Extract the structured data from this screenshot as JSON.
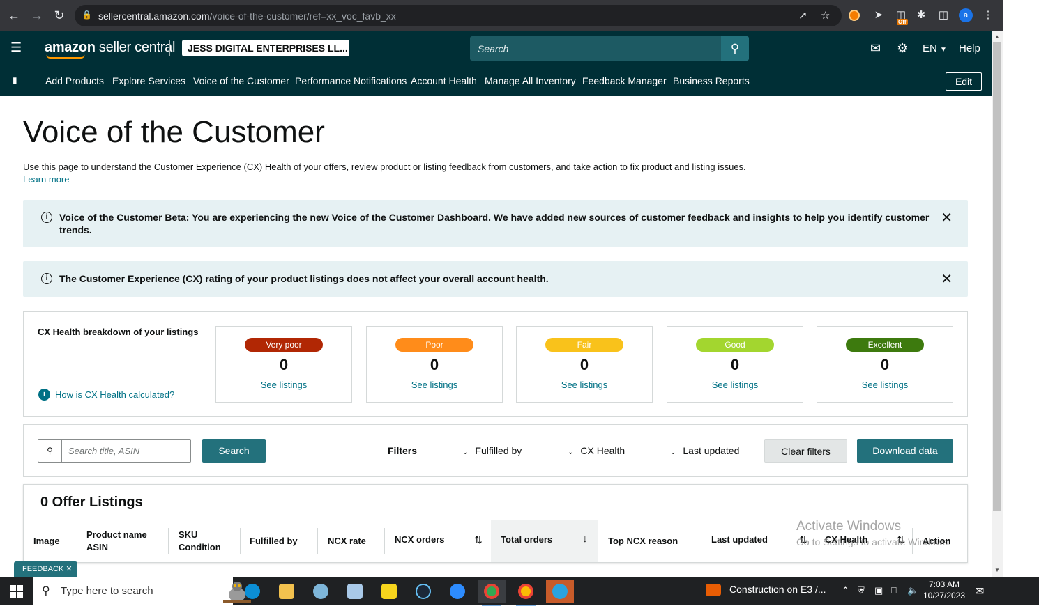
{
  "browser": {
    "url_host": "sellercentral.amazon.com",
    "url_path": "/voice-of-the-customer/ref=xx_voc_favb_xx",
    "profile_initial": "a",
    "ext_badge": "Off"
  },
  "header": {
    "logo_amazon": "amazon",
    "logo_rest": " seller central",
    "account": "JESS DIGITAL ENTERPRISES LL...",
    "search_placeholder": "Search",
    "language": "EN",
    "help": "Help"
  },
  "nav": {
    "links": [
      "Add Products",
      "Explore Services",
      "Voice of the Customer",
      "Performance Notifications",
      "Account Health",
      "Manage All Inventory",
      "Feedback Manager",
      "Business Reports"
    ],
    "edit": "Edit"
  },
  "page": {
    "title": "Voice of the Customer",
    "description": "Use this page to understand the Customer Experience (CX) Health of your offers, review product or listing feedback from customers, and take action to fix product and listing issues.",
    "learn_more": "Learn more"
  },
  "alerts": {
    "beta_line1": "Voice of the Customer Beta: You are experiencing the new Voice of the Customer Dashboard. We have added new sources of customer feedback and insights to help you identify customer",
    "beta_line2": "trends.",
    "cx_rating": "The Customer Experience (CX) rating of your product listings does not affect your overall account health."
  },
  "cx_health": {
    "title": "CX Health breakdown of your listings",
    "help_link": "How is CX Health calculated?",
    "see_listings": "See listings",
    "tiles": [
      {
        "label": "Very poor",
        "count": "0",
        "color": "#b12704"
      },
      {
        "label": "Poor",
        "count": "0",
        "color": "#ff8c1a"
      },
      {
        "label": "Fair",
        "count": "0",
        "color": "#f9c21b"
      },
      {
        "label": "Good",
        "count": "0",
        "color": "#a3d62f"
      },
      {
        "label": "Excellent",
        "count": "0",
        "color": "#3d7a0e"
      }
    ]
  },
  "filters": {
    "search_placeholder": "Search title, ASIN",
    "search_button": "Search",
    "filters_label": "Filters",
    "fulfilled_by": "Fulfilled by",
    "cx_health": "CX Health",
    "last_updated": "Last updated",
    "clear": "Clear filters",
    "download": "Download data"
  },
  "listings": {
    "title": "0 Offer Listings",
    "columns": {
      "image": "Image",
      "product_name": "Product name",
      "asin": "ASIN",
      "sku": "SKU",
      "condition": "Condition",
      "fulfilled_by": "Fulfilled by",
      "ncx_rate": "NCX rate",
      "ncx_orders": "NCX orders",
      "total_orders": "Total orders",
      "top_ncx_reason": "Top NCX reason",
      "last_updated": "Last updated",
      "cx_health": "CX Health",
      "action": "Action"
    }
  },
  "overlay": {
    "activate_title": "Activate Windows",
    "activate_sub": "Go to Settings to activate Windows.",
    "feedback": "FEEDBACK"
  },
  "taskbar": {
    "search_placeholder": "Type here to search",
    "news": "Construction on E3 /...",
    "time": "7:03 AM",
    "date": "10/27/2023"
  }
}
